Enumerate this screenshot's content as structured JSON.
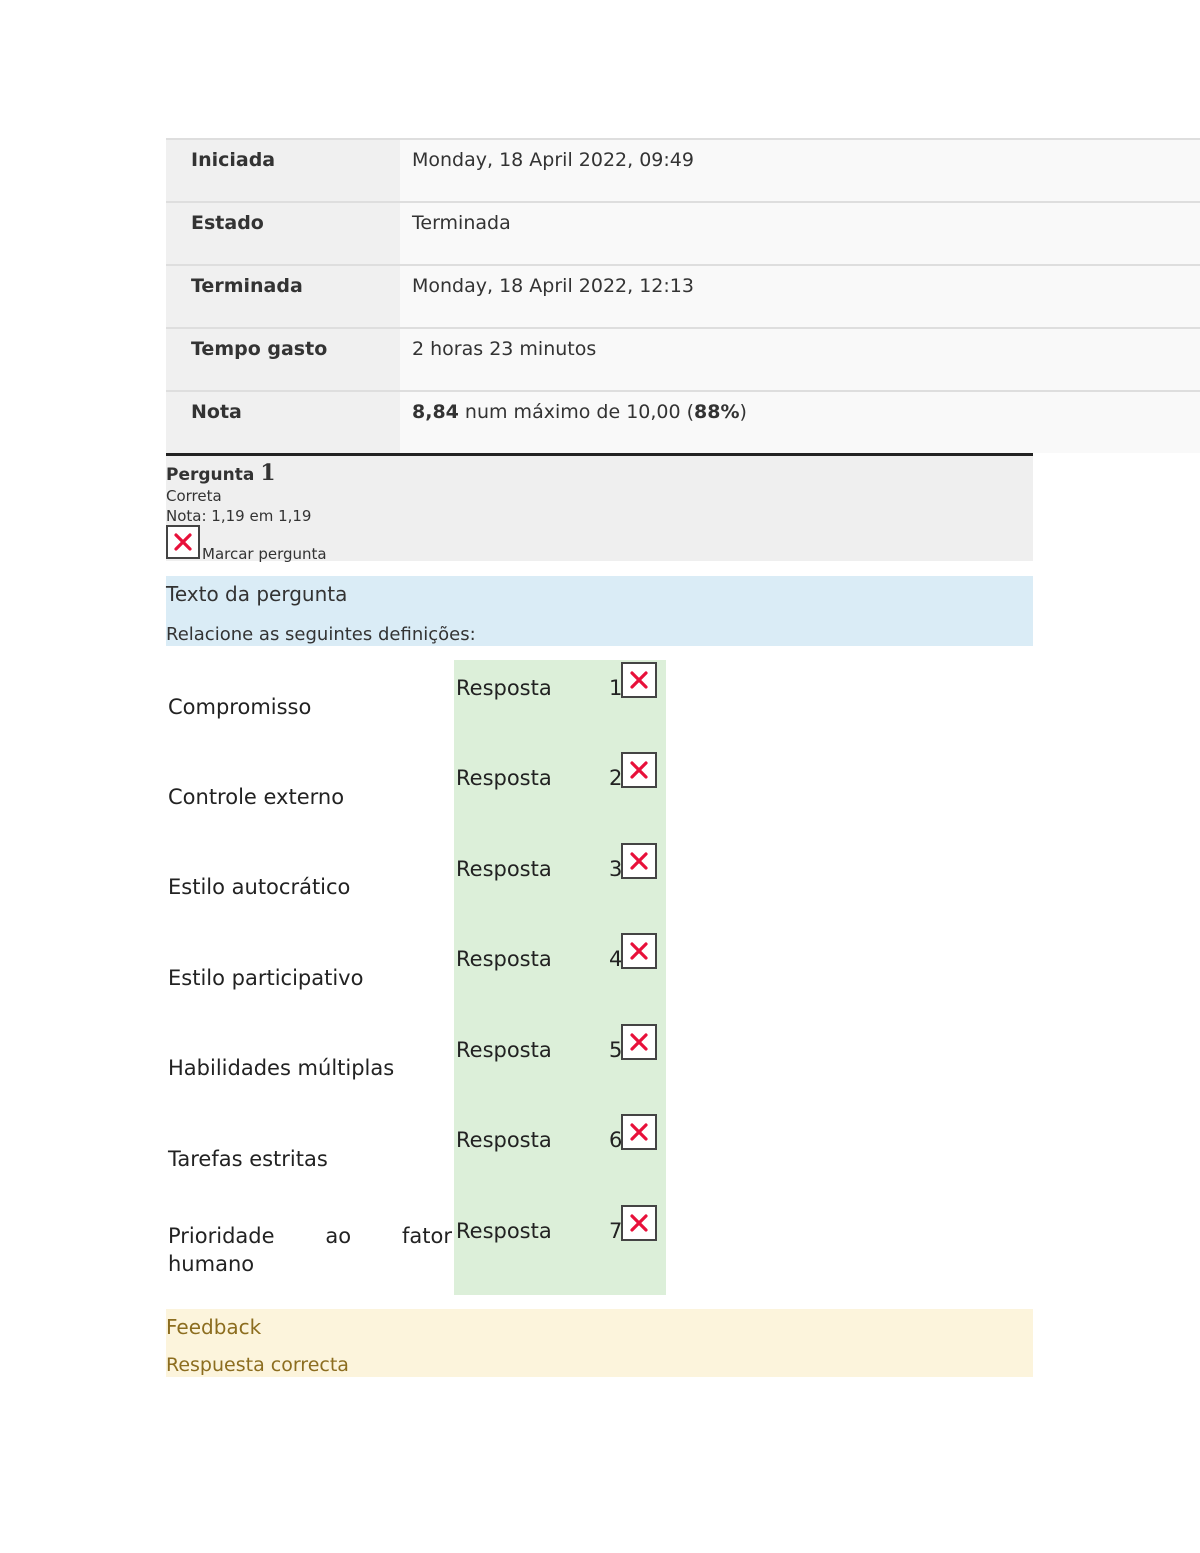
{
  "summary": {
    "rows": [
      {
        "label": "Iniciada",
        "value": "Monday, 18 April 2022, 09:49"
      },
      {
        "label": "Estado",
        "value": "Terminada"
      },
      {
        "label": "Terminada",
        "value": "Monday, 18 April 2022, 12:13"
      },
      {
        "label": "Tempo gasto",
        "value": "2 horas 23 minutos"
      },
      {
        "label": "Nota",
        "grade_value": "8,84",
        "grade_mid": " num máximo de 10,00 (",
        "grade_pct": "88%",
        "grade_end": ")"
      }
    ]
  },
  "question": {
    "label": "Pergunta ",
    "number": "1",
    "state": "Correta",
    "grade": "Nota: 1,19 em 1,19",
    "flag_label": "Marcar pergunta",
    "text_heading": "Texto da pergunta",
    "prompt": "Relacione as seguintes definições:"
  },
  "answers": {
    "response_label": "Resposta",
    "items": [
      {
        "term": "Compromisso",
        "index": "1"
      },
      {
        "term": "Controle externo",
        "index": "2"
      },
      {
        "term": "Estilo autocrático",
        "index": "3"
      },
      {
        "term": "Estilo participativo",
        "index": "4"
      },
      {
        "term": "Habilidades múltiplas",
        "index": "5"
      },
      {
        "term": "Tarefas estritas",
        "index": "6"
      },
      {
        "term": "Prioridade ao fator humano",
        "index": "7"
      }
    ]
  },
  "feedback": {
    "heading": "Feedback",
    "text": "Respuesta correcta"
  },
  "colors": {
    "summary_label_bg": "#f0f0f0",
    "summary_value_bg": "#f9f9f9",
    "question_info_bg": "#efefef",
    "question_text_bg": "#daecf6",
    "answer_bg": "#dcefd9",
    "feedback_bg": "#fcf4dc",
    "feedback_text": "#8c6d1f",
    "broken_image_x": "#e8103a"
  }
}
